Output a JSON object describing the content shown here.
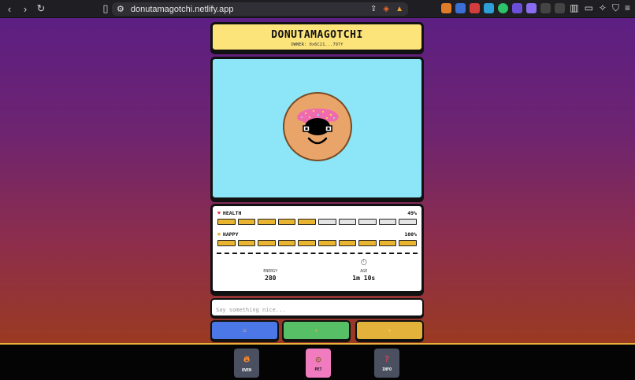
{
  "browser": {
    "url": "donutamagotchi.netlify.app"
  },
  "header": {
    "title": "DONUTAMAGOTCHI",
    "owner": "OWNER: 0x6C21...797f"
  },
  "stats": {
    "health": {
      "icon": "heart-icon",
      "label": "HEALTH",
      "value_text": "49%",
      "filled": 5,
      "total": 10
    },
    "happy": {
      "icon": "smile-icon",
      "label": "HAPPY",
      "value_text": "100%",
      "filled": 10,
      "total": 10
    },
    "energy": {
      "label": "ENERGY",
      "value": "280"
    },
    "age": {
      "icon": "stopwatch-icon",
      "label": "AGE",
      "value": "1m 10s"
    }
  },
  "message": {
    "placeholder": "Say something nice..."
  },
  "actions": [
    {
      "name": "blue-action",
      "icon": "home-icon",
      "color": "#4b78e6"
    },
    {
      "name": "green-action",
      "icon": "pin-icon",
      "color": "#57c067"
    },
    {
      "name": "yellow-action",
      "icon": "sparkle-icon",
      "color": "#e3b23a"
    }
  ],
  "dock": {
    "oven": {
      "label": "OVEN",
      "icon": "fire-icon"
    },
    "pet": {
      "label": "PET",
      "icon": "donut-icon",
      "active": true
    },
    "info": {
      "label": "INFO",
      "icon": "question-icon"
    }
  },
  "colors": {
    "title_bg": "#fde47a",
    "screen_bg": "#8ce6f8",
    "bar_on": "#e9b530",
    "bar_off": "#e4e4e4",
    "pet_tab": "#f07bbf"
  }
}
